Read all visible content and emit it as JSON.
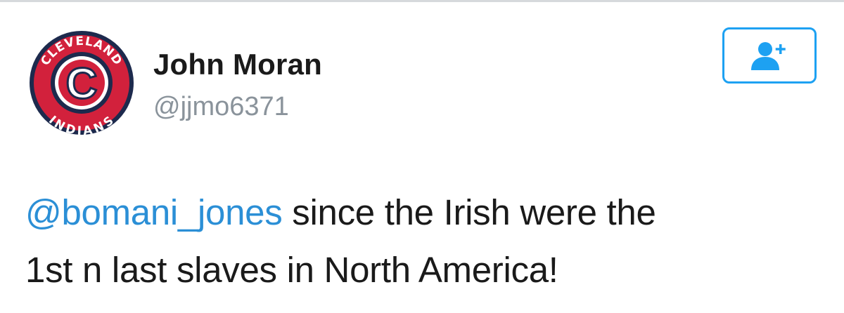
{
  "tweet": {
    "author": {
      "display_name": "John Moran",
      "handle": "@jjmo6371",
      "avatar": {
        "icon": "cleveland-indians-logo",
        "ring_text_top": "CLEVELAND",
        "ring_text_bottom": "INDIANS",
        "center_letter": "C"
      }
    },
    "follow_button": {
      "icon": "add-user-icon"
    },
    "text": {
      "mention": "@bomani_jones",
      "line1_rest": " since the Irish were the",
      "line2": "1st n last slaves in North America!"
    }
  },
  "colors": {
    "accent": "#1da1f2",
    "mention": "#2b8fd6",
    "text": "#1a1a1a",
    "muted": "#8a939b",
    "logo_navy": "#1d2a4d",
    "logo_red": "#d2213c"
  }
}
